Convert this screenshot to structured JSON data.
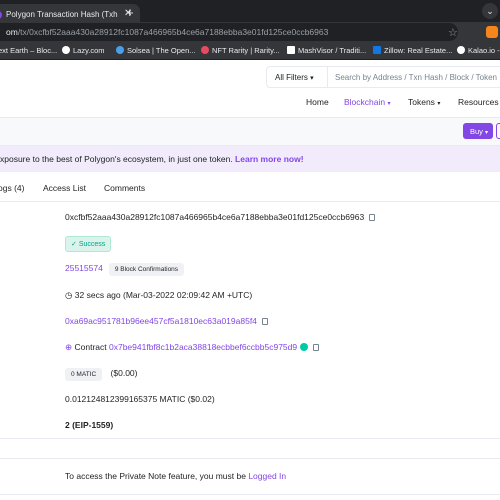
{
  "browser": {
    "tab_title": "Polygon Transaction Hash (Txh",
    "tab_close": "✕",
    "new_tab": "+",
    "url_domain": "om",
    "url_path": "/tx/0xcfbf52aaa430a28912fc1087a466965b4ce6a7188ebba3e01fd125ce0ccb6963",
    "bookmarks": [
      {
        "label": "ext Earth – Bloc...",
        "color": "#35363a"
      },
      {
        "label": "Lazy.com",
        "color": "#ffffff"
      },
      {
        "label": "Solsea | The Open...",
        "color": "#4a9fe8"
      },
      {
        "label": "NFT Rarity | Rarity...",
        "color": "#e84a5f"
      },
      {
        "label": "MashVisor / Traditi...",
        "color": "#ffffff"
      },
      {
        "label": "Zillow: Real Estate...",
        "color": "#1277e1"
      },
      {
        "label": "Kalao.io -",
        "color": "#ffffff"
      }
    ]
  },
  "header": {
    "filter_label": "All Filters",
    "search_placeholder": "Search by Address / Txn Hash / Block / Token",
    "nav": [
      "Home",
      "Blockchain",
      "Tokens",
      "Resources"
    ]
  },
  "buy_label": "Buy",
  "banner": {
    "text": "xposure to the best of Polygon's ecosystem, in just one token.",
    "link": "Learn more now!"
  },
  "tabs": [
    "ogs (4)",
    "Access List",
    "Comments"
  ],
  "details": {
    "tx_hash": "0xcfbf52aaa430a28912fc1087a466965b4ce6a7188ebba3e01fd125ce0ccb6963",
    "status": "Success",
    "block": "25515574",
    "confirmations": "9 Block Confirmations",
    "timestamp": "32 secs ago (Mar-03-2022 02:09:42 AM +UTC)",
    "from": "0xa69ac951781b96ee457cf5a1810ec63a019a85f4",
    "to_prefix": "Contract",
    "to": "0x7be941fbf8c1b2aca38818ecbbef6ccbb5c975d9",
    "value": "0 MATIC",
    "value_usd": "($0.00)",
    "fee": "0.012124812399165375 MATIC ($0.02)",
    "txn_type": "2 (EIP-1559)",
    "private_note_text": "To access the Private Note feature, you must be",
    "private_note_link": "Logged In"
  }
}
